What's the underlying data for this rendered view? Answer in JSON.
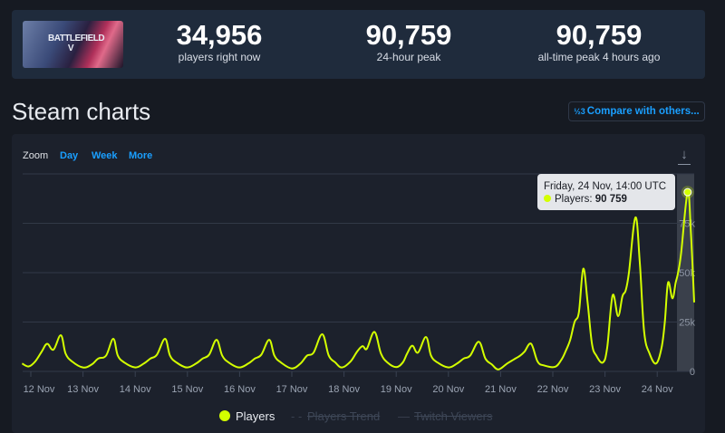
{
  "game": {
    "cover_text": "BATTLEFIELD V"
  },
  "stats": [
    {
      "value": "34,956",
      "label": "players right now"
    },
    {
      "value": "90,759",
      "label": "24-hour peak"
    },
    {
      "value": "90,759",
      "label": "all-time peak 4 hours ago"
    }
  ],
  "section_title": "Steam charts",
  "compare_button": {
    "icon": "fraction-icon",
    "icon_text": "½3",
    "label": "Compare with others..."
  },
  "zoom": {
    "label": "Zoom",
    "options": [
      "Day",
      "Week",
      "More"
    ]
  },
  "download_icon": "download-icon",
  "tooltip": {
    "date": "Friday, 24 Nov, 14:00 UTC",
    "series": "Players:",
    "value": "90 759"
  },
  "legend": [
    {
      "label": "Players",
      "active": true
    },
    {
      "label": "Players Trend",
      "active": false
    },
    {
      "label": "Twitch Viewers",
      "active": false
    }
  ],
  "colors": {
    "line": "#d4ff00",
    "accent": "#1a9fff"
  },
  "chart_data": {
    "type": "line",
    "x_unit": "hours since 12 Nov 00:00 UTC",
    "x_range": [
      -4,
      305
    ],
    "x_ticks": [
      "12 Nov",
      "13 Nov",
      "14 Nov",
      "15 Nov",
      "16 Nov",
      "17 Nov",
      "18 Nov",
      "19 Nov",
      "20 Nov",
      "21 Nov",
      "22 Nov",
      "23 Nov",
      "24 Nov"
    ],
    "y_ticks": [
      "0",
      "25k",
      "50k",
      "75k"
    ],
    "ylim": [
      0,
      100000
    ],
    "grid": true,
    "series": [
      {
        "name": "Players",
        "points": [
          [
            -4,
            4000
          ],
          [
            -1,
            2500
          ],
          [
            2,
            5000
          ],
          [
            5,
            10000
          ],
          [
            7.5,
            14000
          ],
          [
            10.4,
            11000
          ],
          [
            13.8,
            18300
          ],
          [
            16,
            9000
          ],
          [
            19,
            5000
          ],
          [
            24,
            2000
          ],
          [
            28,
            3500
          ],
          [
            31,
            6500
          ],
          [
            34.6,
            8000
          ],
          [
            37.9,
            16500
          ],
          [
            40,
            8000
          ],
          [
            43,
            4500
          ],
          [
            48,
            2000
          ],
          [
            52,
            4000
          ],
          [
            55,
            6500
          ],
          [
            58,
            8500
          ],
          [
            61.7,
            16500
          ],
          [
            64,
            8000
          ],
          [
            67,
            4500
          ],
          [
            71.7,
            2000
          ],
          [
            76,
            4000
          ],
          [
            79,
            6500
          ],
          [
            82,
            8500
          ],
          [
            85.4,
            16000
          ],
          [
            88,
            8000
          ],
          [
            91,
            4500
          ],
          [
            95.8,
            2000
          ],
          [
            100,
            4000
          ],
          [
            103,
            6500
          ],
          [
            106,
            8500
          ],
          [
            109.6,
            16000
          ],
          [
            112,
            8000
          ],
          [
            115,
            4500
          ],
          [
            120,
            1500
          ],
          [
            124,
            4000
          ],
          [
            127,
            8000
          ],
          [
            130,
            9500
          ],
          [
            134,
            18800
          ],
          [
            137,
            8000
          ],
          [
            140,
            4500
          ],
          [
            143,
            2000
          ],
          [
            147,
            5000
          ],
          [
            150,
            10000
          ],
          [
            152.5,
            12800
          ],
          [
            154.5,
            11500
          ],
          [
            158,
            20000
          ],
          [
            161,
            9000
          ],
          [
            164,
            4500
          ],
          [
            168,
            2200
          ],
          [
            171,
            4500
          ],
          [
            173,
            9000
          ],
          [
            175.4,
            13000
          ],
          [
            178,
            9500
          ],
          [
            181.7,
            17400
          ],
          [
            184,
            8000
          ],
          [
            187,
            4500
          ],
          [
            192,
            2000
          ],
          [
            196,
            4000
          ],
          [
            199,
            6500
          ],
          [
            202,
            8000
          ],
          [
            206,
            15000
          ],
          [
            209,
            6500
          ],
          [
            212,
            3500
          ],
          [
            215,
            1000
          ],
          [
            219,
            4000
          ],
          [
            222,
            6000
          ],
          [
            225,
            8000
          ],
          [
            227,
            10000
          ],
          [
            230,
            14000
          ],
          [
            233,
            5000
          ],
          [
            236,
            3000
          ],
          [
            241,
            2300
          ],
          [
            244,
            6000
          ],
          [
            246,
            10500
          ],
          [
            248,
            16000
          ],
          [
            250,
            25000
          ],
          [
            252,
            30000
          ],
          [
            254,
            52000
          ],
          [
            256,
            35000
          ],
          [
            258,
            14000
          ],
          [
            260,
            8000
          ],
          [
            263,
            4500
          ],
          [
            265,
            12000
          ],
          [
            267.5,
            38500
          ],
          [
            270,
            28000
          ],
          [
            272,
            38000
          ],
          [
            273.5,
            41000
          ],
          [
            275,
            50000
          ],
          [
            278,
            78000
          ],
          [
            280,
            55000
          ],
          [
            282,
            20000
          ],
          [
            284.5,
            9000
          ],
          [
            287.5,
            4000
          ],
          [
            290,
            12000
          ],
          [
            291.5,
            25000
          ],
          [
            293,
            45000
          ],
          [
            295,
            37000
          ],
          [
            296.5,
            45000
          ],
          [
            297.5,
            49500
          ],
          [
            299,
            60000
          ],
          [
            302,
            90759
          ],
          [
            303.5,
            70000
          ],
          [
            305,
            34956
          ]
        ]
      }
    ]
  }
}
